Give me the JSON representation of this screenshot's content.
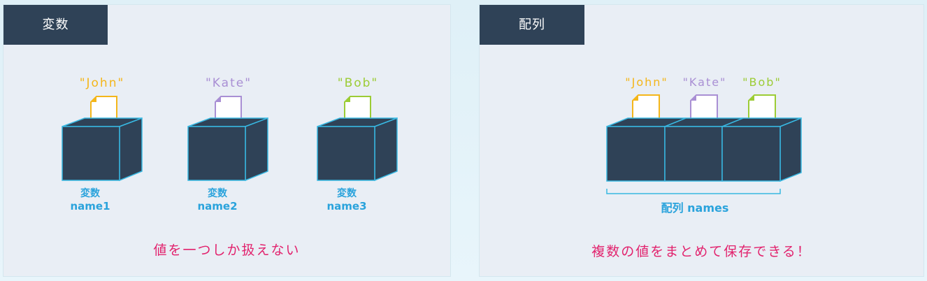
{
  "left_panel": {
    "title": "変数",
    "items": [
      {
        "value": "\"John\"",
        "label_kanji": "変数",
        "label_name": "name1",
        "color": "#f4b61a"
      },
      {
        "value": "\"Kate\"",
        "label_kanji": "変数",
        "label_name": "name2",
        "color": "#a98fd4"
      },
      {
        "value": "\"Bob\"",
        "label_kanji": "変数",
        "label_name": "name3",
        "color": "#9ccc35"
      }
    ],
    "caption": "値を一つしか扱えない"
  },
  "right_panel": {
    "title": "配列",
    "items": [
      {
        "value": "\"John\"",
        "color": "#f4b61a"
      },
      {
        "value": "\"Kate\"",
        "color": "#a98fd4"
      },
      {
        "value": "\"Bob\"",
        "color": "#9ccc35"
      }
    ],
    "array_label": "配列 names",
    "caption": "複数の値をまとめて保存できる！"
  },
  "colors": {
    "box_fill": "#2f4257",
    "box_edge": "#38b8e2",
    "label_blue": "#2aa3dc",
    "caption_pink": "#e2226d",
    "title_bg": "#2f4257"
  }
}
